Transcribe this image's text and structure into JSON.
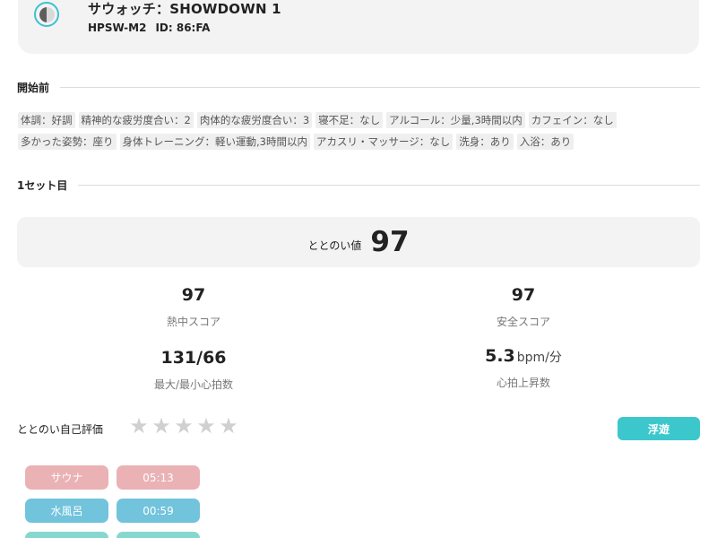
{
  "colors": {
    "accent": "#3cc7cc",
    "sauna": "#eab2b5",
    "water": "#72c3dc",
    "rest": "#86d8cf",
    "star_empty": "#d0d0d0"
  },
  "device": {
    "name": "サウォッチ：SHOWDOWN 1",
    "model": "HPSW-M2",
    "id": "ID: 86:FA",
    "icon": "watch-icon"
  },
  "before": {
    "title": "開始前",
    "tags": [
      "体調：好調",
      "精神的な疲労度合い：2",
      "肉体的な疲労度合い：3",
      "寝不足：なし",
      "アルコール：少量,3時間以内",
      "カフェイン：なし",
      "多かった姿勢：座り",
      "身体トレーニング：軽い運動,3時間以内",
      "アカスリ・マッサージ：なし",
      "洗身：あり",
      "入浴：あり"
    ]
  },
  "set1": {
    "title": "1セット目",
    "totonoi_label": "ととのい値",
    "totonoi_value": "97",
    "stats": {
      "heat_value": "97",
      "heat_label": "熱中スコア",
      "safety_value": "97",
      "safety_label": "安全スコア",
      "hr_value": "131/66",
      "hr_label": "最大/最小心拍数",
      "rise_value": "5.3",
      "rise_unit": "bpm/分",
      "rise_label": "心拍上昇数"
    },
    "self_eval_label": "ととのい自己評価",
    "stars": {
      "rating": 0,
      "max": 5
    },
    "mood": "浮遊",
    "timeline": [
      {
        "label": "サウナ",
        "time": "05:13"
      },
      {
        "label": "水風呂",
        "time": "00:59"
      }
    ]
  }
}
